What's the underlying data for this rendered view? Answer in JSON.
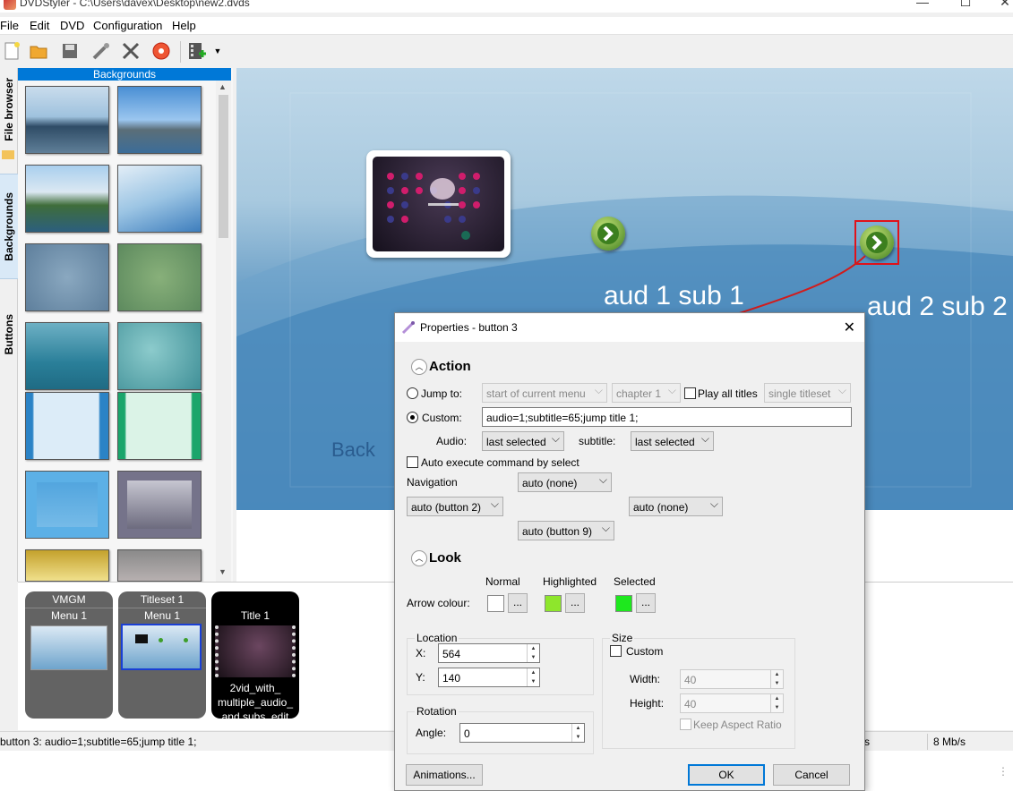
{
  "window": {
    "title": "DVDStyler - C:\\Users\\davex\\Desktop\\new2.dvds",
    "controls": [
      "—",
      "☐",
      "✕"
    ]
  },
  "menu": [
    "File",
    "Edit",
    "DVD",
    "Configuration",
    "Help"
  ],
  "toolbar": {
    "icons": [
      "new-icon",
      "open-icon",
      "save-icon",
      "burn-icon",
      "settings-icon",
      "disc-icon",
      "add-video-icon"
    ]
  },
  "side_tabs": [
    "File browser",
    "Backgrounds",
    "Buttons"
  ],
  "backgrounds": {
    "header": "Backgrounds"
  },
  "canvas": {
    "label1": "aud 1 sub 1",
    "label2": "aud 2 sub 2",
    "back": "Back"
  },
  "titleset_strip": {
    "vmgm": "VMGM",
    "vmgm_menu": "Menu 1",
    "titleset": "Titleset 1",
    "titleset_menu": "Menu 1",
    "title": "Title 1",
    "title_caption": "2vid_with_ multiple_audio_ and subs_edit"
  },
  "status": {
    "text": "button 3: audio=1;subtitle=65;jump title 1;",
    "s_fragment": "s",
    "bitrate": "8 Mb/s"
  },
  "dialog": {
    "title": "Properties - button 3",
    "action_header": "Action",
    "jump_to_label": "Jump to:",
    "jump_target": "start of current menu",
    "jump_chapter": "chapter 1",
    "play_all_label": "Play all titles",
    "titleset_mode": "single titleset",
    "custom_label": "Custom:",
    "custom_value": "audio=1;subtitle=65;jump title 1;",
    "audio_label": "Audio:",
    "audio_value": "last selected",
    "subtitle_label": "subtitle:",
    "subtitle_value": "last selected",
    "auto_exec_label": "Auto execute command by select",
    "navigation_label": "Navigation",
    "nav_up": "auto (none)",
    "nav_left": "auto (button 2)",
    "nav_right": "auto (none)",
    "nav_down": "auto (button 9)",
    "look_header": "Look",
    "normal_label": "Normal",
    "highlighted_label": "Highlighted",
    "selected_label": "Selected",
    "arrow_colour_label": "Arrow colour:",
    "ellipsis": "...",
    "colors": {
      "normal": "#ffffff",
      "highlighted": "#8ee62c",
      "selected": "#1ee81e"
    },
    "location_label": "Location",
    "x_label": "X:",
    "x_value": "564",
    "y_label": "Y:",
    "y_value": "140",
    "size_label": "Size",
    "size_custom_label": "Custom",
    "width_label": "Width:",
    "width_value": "40",
    "height_label": "Height:",
    "height_value": "40",
    "keep_aspect_label": "Keep Aspect Ratio",
    "rotation_label": "Rotation",
    "angle_label": "Angle:",
    "angle_value": "0",
    "animations_btn": "Animations...",
    "ok_btn": "OK",
    "cancel_btn": "Cancel"
  }
}
